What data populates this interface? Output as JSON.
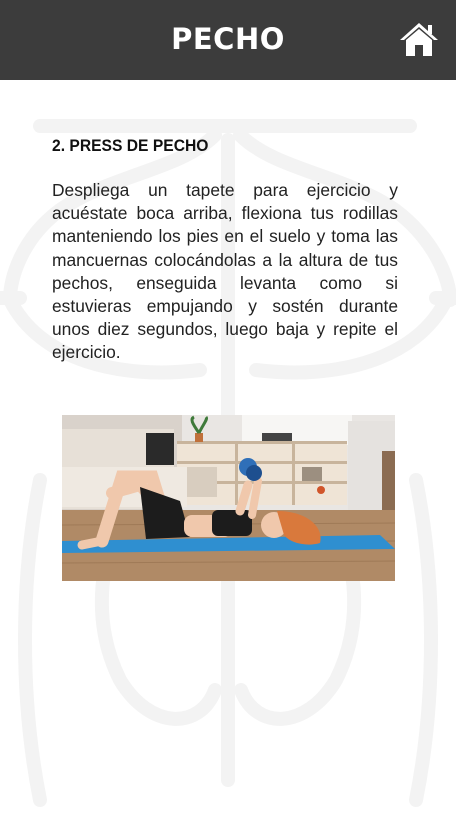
{
  "header": {
    "title": "PECHO",
    "home_icon": "home-icon",
    "background": "#3c3c3c"
  },
  "exercise": {
    "title": "2. PRESS DE PECHO",
    "description": "Despliega un tapete para ejercicio y acuéstate boca arriba, flexiona tus rodillas manteniendo los pies en el suelo y toma las mancuernas colocándolas a la altura de tus pechos, enseguida levanta como si estuvieras empujando y sostén durante unos diez segundos, luego baja y repite el ejercicio.",
    "image_alt": "exercise-photo"
  },
  "colors": {
    "mat": "#2f8fd0",
    "dumbbell": "#2f6fb8",
    "floor": "#b08a66"
  }
}
